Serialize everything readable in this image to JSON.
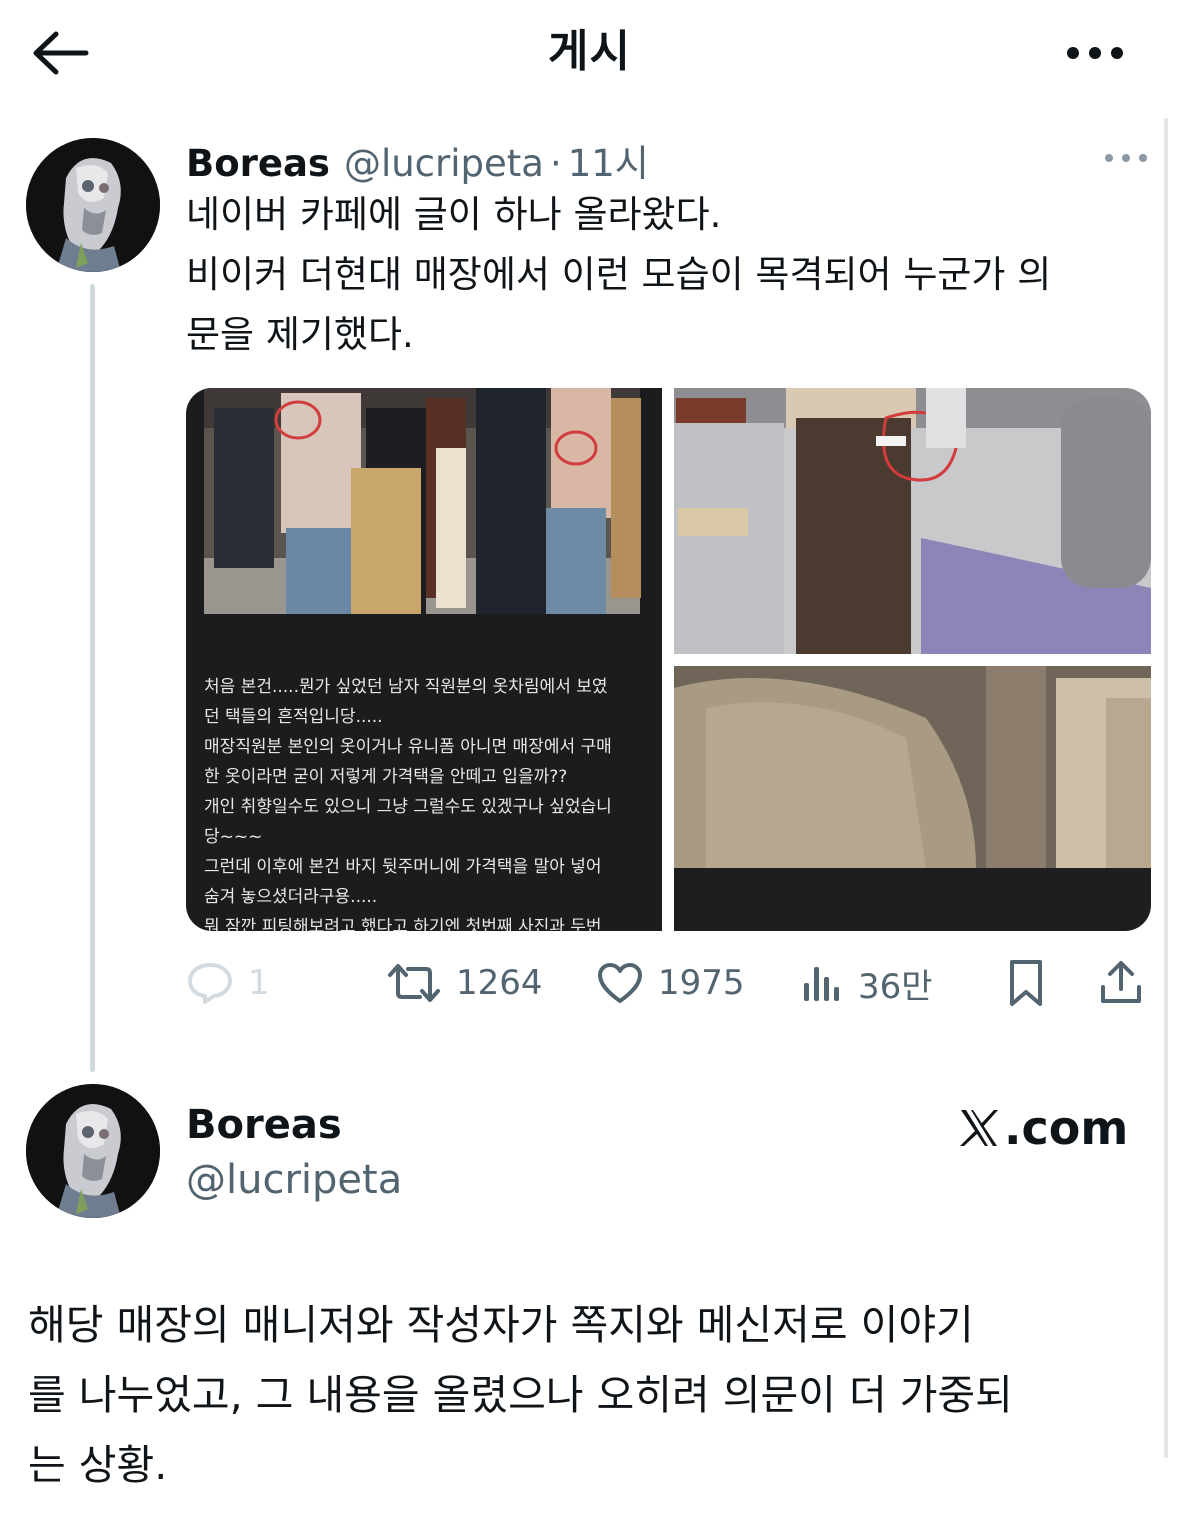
{
  "header": {
    "title": "게시",
    "back_icon": "arrow-left-icon",
    "more_icon": "more-horizontal-icon"
  },
  "tweet": {
    "author_name": "Boreas",
    "author_handle": "@lucripeta",
    "separator": "·",
    "time": "11시",
    "text_lines": [
      "네이버 카페에 글이 하나 올라왔다.",
      "비이커 더현대 매장에서 이런 모습이 목격되어 누군가 의",
      "문을 제기했다."
    ],
    "media": {
      "screenshot_text_lines": [
        "처음 본건.....뭔가 싶었던 남자 직원분의 옷차림에서 보였",
        "던 택들의 흔적입니당.....",
        "매장직원분 본인의 옷이거나 유니폼 아니면 매장에서 구매",
        "한 옷이라면 굳이 저렇게 가격택을 안떼고 입을까??",
        "개인 취향일수도 있으니 그냥 그럴수도 있겠구나 싶었습니",
        "당~~~",
        "그런데 이후에 본건 바지 뒷주머니에 가격택을 말아 넣어",
        "숨겨 놓으셨더라구용.....",
        "뭐 잠깐 피팅해보려고 했다고 하기엔 첫번째 사진과 두번"
      ]
    },
    "actions": {
      "reply_count": "1",
      "retweet_count": "1264",
      "like_count": "1975",
      "view_count": "36만"
    }
  },
  "footer_card": {
    "name": "Boreas",
    "handle": "@lucripeta",
    "site": ".com",
    "site_logo": "x-logo-icon"
  },
  "caption_lines": [
    "해당 매장의 매니저와 작성자가 쪽지와 메신저로 이야기",
    "를 나누었고, 그 내용을 올렸으나 오히려 의문이 더 가중되",
    "는 상황."
  ],
  "colors": {
    "text_primary": "#0f1419",
    "text_secondary": "#536471",
    "thread_line": "#cfd9de",
    "faded_icon": "#d3dbe0"
  }
}
